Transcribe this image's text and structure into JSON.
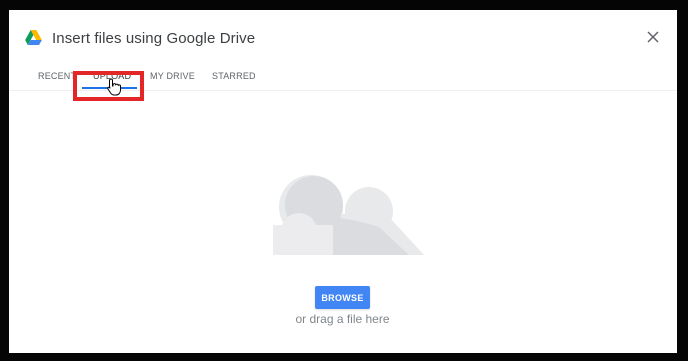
{
  "dialog": {
    "title": "Insert files using Google Drive",
    "logo_icon": "google-drive-icon",
    "close_icon": "close-icon"
  },
  "tabs": [
    {
      "label": "RECENT",
      "selected": false
    },
    {
      "label": "UPLOAD",
      "selected": true
    },
    {
      "label": "MY DRIVE",
      "selected": false
    },
    {
      "label": "STARRED",
      "selected": false
    }
  ],
  "upload": {
    "illustration": "cloud-icon",
    "browse_label": "BROWSE",
    "drag_hint": "or drag a file here"
  },
  "colors": {
    "accent": "#4285f4",
    "tab_indicator": "#1a73e8",
    "highlight": "#e32626",
    "frame": "#050505"
  }
}
